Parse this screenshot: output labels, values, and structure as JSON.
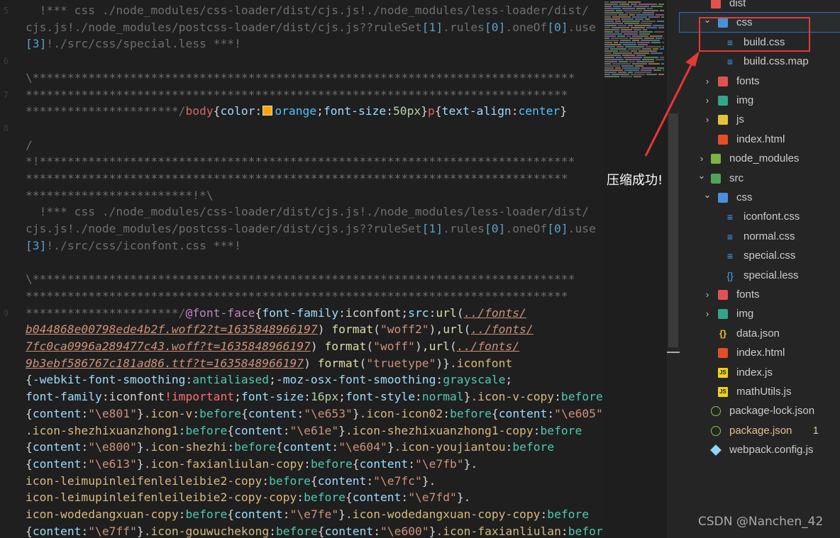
{
  "editor": {
    "gutter": [
      "5",
      "",
      "",
      "6",
      "",
      "7",
      "",
      "8",
      "",
      "",
      "",
      "",
      "",
      "",
      "",
      "",
      "",
      "",
      "9",
      "",
      "",
      "",
      "",
      "",
      "",
      "",
      "",
      "",
      "",
      ""
    ],
    "lines": [
      [
        [
          "c",
          "  !*** css ./node_modules/css-loader/dist/cjs.js!./node_modules/less-loader/dist/"
        ]
      ],
      [
        [
          "c",
          "cjs.js!./node_modules/postcss-loader/dist/cjs.js??ruleSet"
        ],
        [
          "cb",
          "[1]"
        ],
        [
          "c",
          ".rules"
        ],
        [
          "cb",
          "[0]"
        ],
        [
          "c",
          ".oneOf"
        ],
        [
          "cb",
          "[0]"
        ],
        [
          "c",
          ".use"
        ]
      ],
      [
        [
          "cb",
          "[3]"
        ],
        [
          "c",
          "!./src/css/special.less ***!"
        ]
      ],
      [
        [
          "c",
          ""
        ]
      ],
      [
        [
          "c",
          "\\******************************************************************************"
        ]
      ],
      [
        [
          "c",
          "******************************************************************************"
        ]
      ],
      [
        [
          "c",
          "**********************/"
        ],
        [
          "tag",
          "body"
        ],
        [
          "pu",
          "{"
        ],
        [
          "prop",
          "color"
        ],
        [
          "pu",
          ":"
        ],
        [
          "swatch",
          ""
        ],
        [
          "kc",
          "orange"
        ],
        [
          "pu",
          ";"
        ],
        [
          "prop",
          "font-size"
        ],
        [
          "pu",
          ":"
        ],
        [
          "num",
          "50px"
        ],
        [
          "pu",
          "}"
        ],
        [
          "tag",
          "p"
        ],
        [
          "pu",
          "{"
        ],
        [
          "prop",
          "text-align"
        ],
        [
          "pu",
          ":"
        ],
        [
          "kc",
          "center"
        ],
        [
          "pu",
          "}"
        ]
      ],
      [
        [
          "c",
          ""
        ]
      ],
      [
        [
          "c",
          "/"
        ]
      ],
      [
        [
          "c",
          "*!*****************************************************************************"
        ]
      ],
      [
        [
          "c",
          "******************************************************************************"
        ]
      ],
      [
        [
          "c",
          "************************!*\\"
        ]
      ],
      [
        [
          "c",
          "  !*** css ./node_modules/css-loader/dist/cjs.js!./node_modules/less-loader/dist/"
        ]
      ],
      [
        [
          "c",
          "cjs.js!./node_modules/postcss-loader/dist/cjs.js??ruleSet"
        ],
        [
          "cb",
          "[1]"
        ],
        [
          "c",
          ".rules"
        ],
        [
          "cb",
          "[0]"
        ],
        [
          "c",
          ".oneOf"
        ],
        [
          "cb",
          "[0]"
        ],
        [
          "c",
          ".use"
        ]
      ],
      [
        [
          "cb",
          "[3]"
        ],
        [
          "c",
          "!./src/css/iconfont.css ***!"
        ]
      ],
      [
        [
          "c",
          ""
        ]
      ],
      [
        [
          "c",
          "\\******************************************************************************"
        ]
      ],
      [
        [
          "c",
          "******************************************************************************"
        ]
      ],
      [
        [
          "c",
          "**********************/"
        ],
        [
          "at",
          "@font-face"
        ],
        [
          "pu",
          "{"
        ],
        [
          "prop",
          "font-family"
        ],
        [
          "pu",
          ":iconfont;"
        ],
        [
          "prop",
          "src"
        ],
        [
          "pu",
          ":"
        ],
        [
          "fn",
          "url"
        ],
        [
          "pu",
          "("
        ],
        [
          "url",
          "../fonts/"
        ]
      ],
      [
        [
          "url",
          "b044868e00798ede4b2f.woff2?t=1635848966197"
        ],
        [
          "pu",
          ") "
        ],
        [
          "fn",
          "format"
        ],
        [
          "pu",
          "("
        ],
        [
          "str",
          "\"woff2\""
        ],
        [
          "pu",
          "),"
        ],
        [
          "fn",
          "url"
        ],
        [
          "pu",
          "("
        ],
        [
          "url",
          "../fonts/"
        ]
      ],
      [
        [
          "url",
          "7fc0ca0996a289477c43.woff?t=1635848966197"
        ],
        [
          "pu",
          ") "
        ],
        [
          "fn",
          "format"
        ],
        [
          "pu",
          "("
        ],
        [
          "str",
          "\"woff\""
        ],
        [
          "pu",
          "),"
        ],
        [
          "fn",
          "url"
        ],
        [
          "pu",
          "("
        ],
        [
          "url",
          "../fonts/"
        ]
      ],
      [
        [
          "url",
          "9b3ebf586767c181ad86.ttf?t=1635848966197"
        ],
        [
          "pu",
          ") "
        ],
        [
          "fn",
          "format"
        ],
        [
          "pu",
          "("
        ],
        [
          "str",
          "\"truetype\""
        ],
        [
          "pu",
          ")}"
        ],
        [
          "sel",
          ".iconfont"
        ]
      ],
      [
        [
          "pu",
          "{"
        ],
        [
          "prop",
          "-webkit-font-smoothing"
        ],
        [
          "pu",
          ":"
        ],
        [
          "kw",
          "antialiased"
        ],
        [
          "pu",
          ";"
        ],
        [
          "prop",
          "-moz-osx-font-smoothing"
        ],
        [
          "pu",
          ":"
        ],
        [
          "kw",
          "grayscale"
        ],
        [
          "pu",
          ";"
        ]
      ],
      [
        [
          "prop",
          "font-family"
        ],
        [
          "pu",
          ":iconfont"
        ],
        [
          "pk",
          "!important"
        ],
        [
          "pu",
          ";"
        ],
        [
          "prop",
          "font-size"
        ],
        [
          "pu",
          ":"
        ],
        [
          "num",
          "16px"
        ],
        [
          "pu",
          ";"
        ],
        [
          "prop",
          "font-style"
        ],
        [
          "pu",
          ":"
        ],
        [
          "kw",
          "normal"
        ],
        [
          "pu",
          "}"
        ],
        [
          "sel",
          ".icon-v-copy"
        ],
        [
          "pu",
          ":"
        ],
        [
          "kw",
          "before"
        ]
      ],
      [
        [
          "pu",
          "{"
        ],
        [
          "prop",
          "content"
        ],
        [
          "pu",
          ":"
        ],
        [
          "str",
          "\"\\e801\""
        ],
        [
          "pu",
          "}"
        ],
        [
          "sel",
          ".icon-v"
        ],
        [
          "pu",
          ":"
        ],
        [
          "kw",
          "before"
        ],
        [
          "pu",
          "{"
        ],
        [
          "prop",
          "content"
        ],
        [
          "pu",
          ":"
        ],
        [
          "str",
          "\"\\e653\""
        ],
        [
          "pu",
          "}"
        ],
        [
          "sel",
          ".icon-icon02"
        ],
        [
          "pu",
          ":"
        ],
        [
          "kw",
          "before"
        ],
        [
          "pu",
          "{"
        ],
        [
          "prop",
          "content"
        ],
        [
          "pu",
          ":"
        ],
        [
          "str",
          "\"\\e605\""
        ],
        [
          "pu",
          "}"
        ]
      ],
      [
        [
          "sel",
          ".icon-shezhixuanzhong1"
        ],
        [
          "pu",
          ":"
        ],
        [
          "kw",
          "before"
        ],
        [
          "pu",
          "{"
        ],
        [
          "prop",
          "content"
        ],
        [
          "pu",
          ":"
        ],
        [
          "str",
          "\"\\e61e\""
        ],
        [
          "pu",
          "}"
        ],
        [
          "sel",
          ".icon-shezhixuanzhong1-copy"
        ],
        [
          "pu",
          ":"
        ],
        [
          "kw",
          "before"
        ]
      ],
      [
        [
          "pu",
          "{"
        ],
        [
          "prop",
          "content"
        ],
        [
          "pu",
          ":"
        ],
        [
          "str",
          "\"\\e800\""
        ],
        [
          "pu",
          "}"
        ],
        [
          "sel",
          ".icon-shezhi"
        ],
        [
          "pu",
          ":"
        ],
        [
          "kw",
          "before"
        ],
        [
          "pu",
          "{"
        ],
        [
          "prop",
          "content"
        ],
        [
          "pu",
          ":"
        ],
        [
          "str",
          "\"\\e604\""
        ],
        [
          "pu",
          "}"
        ],
        [
          "sel",
          ".icon-youjiantou"
        ],
        [
          "pu",
          ":"
        ],
        [
          "kw",
          "before"
        ]
      ],
      [
        [
          "pu",
          "{"
        ],
        [
          "prop",
          "content"
        ],
        [
          "pu",
          ":"
        ],
        [
          "str",
          "\"\\e613\""
        ],
        [
          "pu",
          "}"
        ],
        [
          "sel",
          ".icon-faxianliulan-copy"
        ],
        [
          "pu",
          ":"
        ],
        [
          "kw",
          "before"
        ],
        [
          "pu",
          "{"
        ],
        [
          "prop",
          "content"
        ],
        [
          "pu",
          ":"
        ],
        [
          "str",
          "\"\\e7fb\""
        ],
        [
          "pu",
          "}."
        ]
      ],
      [
        [
          "sel",
          "icon-leimupinleifenleileibie2-copy"
        ],
        [
          "pu",
          ":"
        ],
        [
          "kw",
          "before"
        ],
        [
          "pu",
          "{"
        ],
        [
          "prop",
          "content"
        ],
        [
          "pu",
          ":"
        ],
        [
          "str",
          "\"\\e7fc\""
        ],
        [
          "pu",
          "}."
        ]
      ],
      [
        [
          "sel",
          "icon-leimupinleifenleileibie2-copy-copy"
        ],
        [
          "pu",
          ":"
        ],
        [
          "kw",
          "before"
        ],
        [
          "pu",
          "{"
        ],
        [
          "prop",
          "content"
        ],
        [
          "pu",
          ":"
        ],
        [
          "str",
          "\"\\e7fd\""
        ],
        [
          "pu",
          "}."
        ]
      ],
      [
        [
          "sel",
          "icon-wodedangxuan-copy"
        ],
        [
          "pu",
          ":"
        ],
        [
          "kw",
          "before"
        ],
        [
          "pu",
          "{"
        ],
        [
          "prop",
          "content"
        ],
        [
          "pu",
          ":"
        ],
        [
          "str",
          "\"\\e7fe\""
        ],
        [
          "pu",
          "}"
        ],
        [
          "sel",
          ".icon-wodedangxuan-copy-copy"
        ],
        [
          "pu",
          ":"
        ],
        [
          "kw",
          "before"
        ]
      ],
      [
        [
          "pu",
          "{"
        ],
        [
          "prop",
          "content"
        ],
        [
          "pu",
          ":"
        ],
        [
          "str",
          "\"\\e7ff\""
        ],
        [
          "pu",
          "}"
        ],
        [
          "sel",
          ".icon-gouwuchekong"
        ],
        [
          "pu",
          ":"
        ],
        [
          "kw",
          "before"
        ],
        [
          "pu",
          "{"
        ],
        [
          "prop",
          "content"
        ],
        [
          "pu",
          ":"
        ],
        [
          "str",
          "\"\\e600\""
        ],
        [
          "pu",
          "}"
        ],
        [
          "sel",
          ".icon-faxianliulan"
        ],
        [
          "pu",
          ":"
        ],
        [
          "kw",
          "before"
        ]
      ]
    ]
  },
  "explorer": {
    "items": [
      {
        "label": "dist",
        "depth": 0,
        "chev": "",
        "icon": "folder-red",
        "name": "tree-folder-dist"
      },
      {
        "label": "css",
        "depth": 1,
        "chev": "⌄",
        "icon": "folder-blue",
        "name": "tree-folder-dist-css",
        "selected": true
      },
      {
        "label": "build.css",
        "depth": 2,
        "chev": "",
        "icon": "css",
        "name": "tree-file-build-css"
      },
      {
        "label": "build.css.map",
        "depth": 2,
        "chev": "",
        "icon": "css",
        "name": "tree-file-build-css-map"
      },
      {
        "label": "fonts",
        "depth": 1,
        "chev": "›",
        "icon": "folder-red",
        "name": "tree-folder-dist-fonts"
      },
      {
        "label": "img",
        "depth": 1,
        "chev": "›",
        "icon": "folder-green",
        "name": "tree-folder-dist-img"
      },
      {
        "label": "js",
        "depth": 1,
        "chev": "›",
        "icon": "folder-yellow",
        "name": "tree-folder-dist-js"
      },
      {
        "label": "index.html",
        "depth": 1,
        "chev": "",
        "icon": "html",
        "name": "tree-file-dist-index-html"
      },
      {
        "label": "node_modules",
        "depth": 0,
        "chev": "›",
        "icon": "folder-node",
        "name": "tree-folder-node-modules"
      },
      {
        "label": "src",
        "depth": 0,
        "chev": "⌄",
        "icon": "folder-src",
        "name": "tree-folder-src"
      },
      {
        "label": "css",
        "depth": 1,
        "chev": "⌄",
        "icon": "folder-blue",
        "name": "tree-folder-src-css"
      },
      {
        "label": "iconfont.css",
        "depth": 2,
        "chev": "",
        "icon": "css",
        "name": "tree-file-iconfont-css"
      },
      {
        "label": "normal.css",
        "depth": 2,
        "chev": "",
        "icon": "css",
        "name": "tree-file-normal-css"
      },
      {
        "label": "special.css",
        "depth": 2,
        "chev": "",
        "icon": "css",
        "name": "tree-file-special-css"
      },
      {
        "label": "special.less",
        "depth": 2,
        "chev": "",
        "icon": "less",
        "name": "tree-file-special-less"
      },
      {
        "label": "fonts",
        "depth": 1,
        "chev": "›",
        "icon": "folder-red",
        "name": "tree-folder-src-fonts"
      },
      {
        "label": "img",
        "depth": 1,
        "chev": "›",
        "icon": "folder-green",
        "name": "tree-folder-src-img"
      },
      {
        "label": "data.json",
        "depth": 1,
        "chev": "",
        "icon": "json",
        "name": "tree-file-data-json"
      },
      {
        "label": "index.html",
        "depth": 1,
        "chev": "",
        "icon": "html",
        "name": "tree-file-src-index-html"
      },
      {
        "label": "index.js",
        "depth": 1,
        "chev": "",
        "icon": "js",
        "name": "tree-file-index-js"
      },
      {
        "label": "mathUtils.js",
        "depth": 1,
        "chev": "",
        "icon": "js",
        "name": "tree-file-mathutils-js"
      },
      {
        "label": "package-lock.json",
        "depth": 0,
        "chev": "",
        "icon": "npm",
        "name": "tree-file-package-lock-json"
      },
      {
        "label": "package.json",
        "depth": 0,
        "chev": "",
        "icon": "npm",
        "name": "tree-file-package-json",
        "badge": "1",
        "modified": true
      },
      {
        "label": "webpack.config.js",
        "depth": 0,
        "chev": "",
        "icon": "webpack",
        "name": "tree-file-webpack-config-js"
      }
    ]
  },
  "annotation": {
    "note": "压缩成功!"
  },
  "watermark": "CSDN @Nanchen_42"
}
